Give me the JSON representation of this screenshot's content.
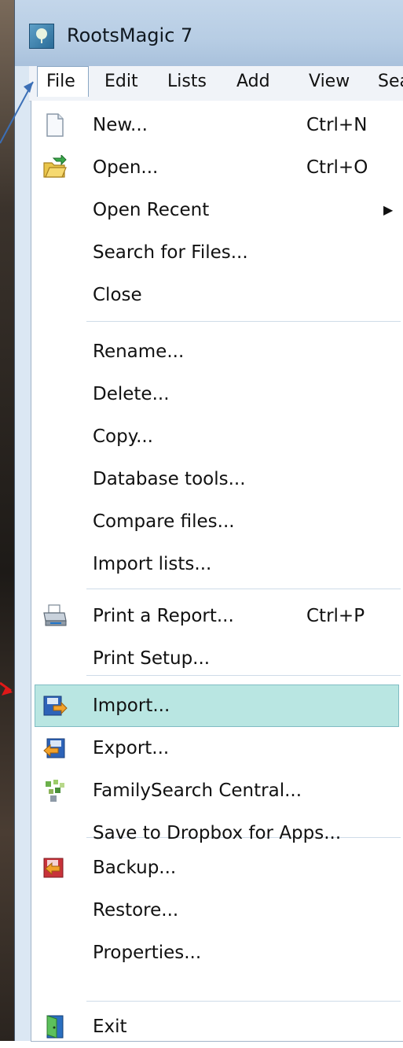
{
  "window": {
    "title": "RootsMagic 7"
  },
  "menubar": {
    "items": [
      {
        "label": "File"
      },
      {
        "label": "Edit"
      },
      {
        "label": "Lists"
      },
      {
        "label": "Add"
      },
      {
        "label": "View"
      },
      {
        "label": "Sea"
      }
    ]
  },
  "file_menu": {
    "items": [
      {
        "label": "New...",
        "shortcut": "Ctrl+N",
        "icon": "new-file-icon"
      },
      {
        "label": "Open...",
        "shortcut": "Ctrl+O",
        "icon": "open-folder-icon"
      },
      {
        "label": "Open Recent",
        "shortcut": "",
        "submenu": true
      },
      {
        "label": "Search for Files...",
        "shortcut": ""
      },
      {
        "label": "Close",
        "shortcut": ""
      },
      {
        "label": "Rename...",
        "shortcut": ""
      },
      {
        "label": "Delete...",
        "shortcut": ""
      },
      {
        "label": "Copy...",
        "shortcut": ""
      },
      {
        "label": "Database tools...",
        "shortcut": ""
      },
      {
        "label": "Compare files...",
        "shortcut": ""
      },
      {
        "label": "Import lists...",
        "shortcut": ""
      },
      {
        "label": "Print a Report...",
        "shortcut": "Ctrl+P",
        "icon": "printer-icon"
      },
      {
        "label": "Print Setup...",
        "shortcut": ""
      },
      {
        "label": "Import...",
        "shortcut": "",
        "icon": "import-icon",
        "highlighted": true
      },
      {
        "label": "Export...",
        "shortcut": "",
        "icon": "export-icon"
      },
      {
        "label": "FamilySearch Central...",
        "shortcut": "",
        "icon": "familysearch-icon"
      },
      {
        "label": "Save to Dropbox for Apps...",
        "shortcut": ""
      },
      {
        "label": "Backup...",
        "shortcut": "",
        "icon": "backup-icon"
      },
      {
        "label": "Restore...",
        "shortcut": ""
      },
      {
        "label": "Properties...",
        "shortcut": ""
      },
      {
        "label": "Exit",
        "shortcut": "",
        "icon": "exit-door-icon"
      }
    ]
  },
  "colors": {
    "highlight": "#b9e6e2",
    "highlight_border": "#7fbcc3",
    "annotation_blue": "#3b6fb6",
    "annotation_red": "#e01818"
  }
}
